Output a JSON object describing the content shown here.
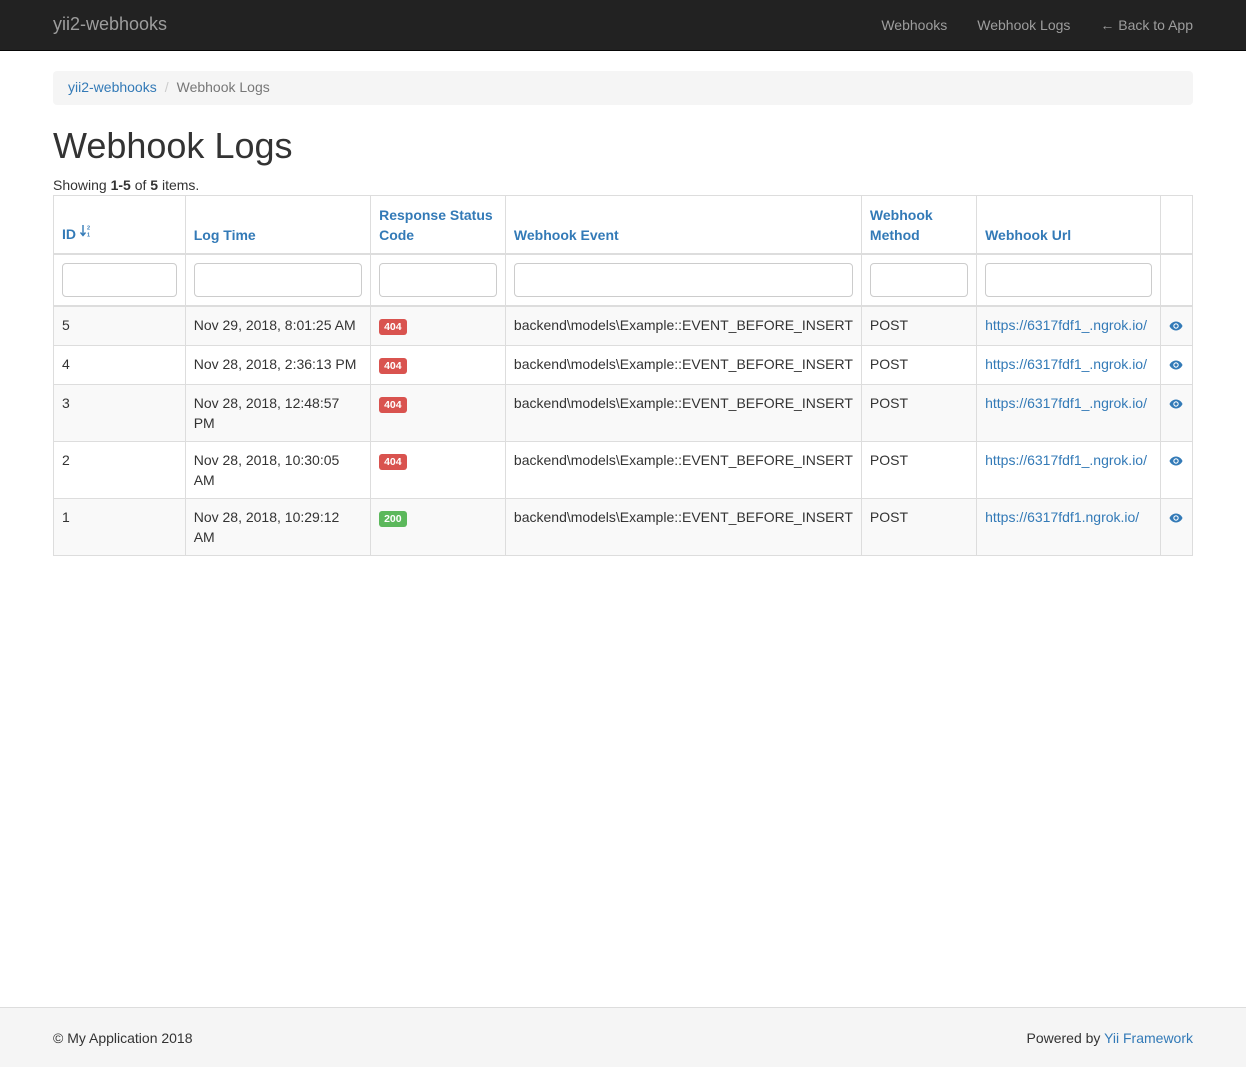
{
  "navbar": {
    "brand": "yii2-webhooks",
    "links": [
      "Webhooks",
      "Webhook Logs",
      "← Back to App"
    ]
  },
  "breadcrumb": {
    "home": "yii2-webhooks",
    "separator": "/",
    "current": "Webhook Logs"
  },
  "page_title": "Webhook Logs",
  "summary": {
    "prefix": "Showing ",
    "range": "1-5",
    "of": " of ",
    "total": "5",
    "suffix": " items."
  },
  "table": {
    "columns": [
      "ID",
      "Log Time",
      "Response Status Code",
      "Webhook Event",
      "Webhook Method",
      "Webhook Url"
    ],
    "rows": [
      {
        "id": "5",
        "time": "Nov 29, 2018, 8:01:25 AM",
        "status": "404",
        "event": "backend\\models\\Example::EVENT_BEFORE_INSERT",
        "method": "POST",
        "url": "https://6317fdf1_.ngrok.io/"
      },
      {
        "id": "4",
        "time": "Nov 28, 2018, 2:36:13 PM",
        "status": "404",
        "event": "backend\\models\\Example::EVENT_BEFORE_INSERT",
        "method": "POST",
        "url": "https://6317fdf1_.ngrok.io/"
      },
      {
        "id": "3",
        "time": "Nov 28, 2018, 12:48:57 PM",
        "status": "404",
        "event": "backend\\models\\Example::EVENT_BEFORE_INSERT",
        "method": "POST",
        "url": "https://6317fdf1_.ngrok.io/"
      },
      {
        "id": "2",
        "time": "Nov 28, 2018, 10:30:05 AM",
        "status": "404",
        "event": "backend\\models\\Example::EVENT_BEFORE_INSERT",
        "method": "POST",
        "url": "https://6317fdf1_.ngrok.io/"
      },
      {
        "id": "1",
        "time": "Nov 28, 2018, 10:29:12 AM",
        "status": "200",
        "event": "backend\\models\\Example::EVENT_BEFORE_INSERT",
        "method": "POST",
        "url": "https://6317fdf1.ngrok.io/"
      }
    ]
  },
  "icons": {
    "sort": "sort-numeric-asc-icon",
    "view": "eye-icon"
  },
  "colors": {
    "navbar": "#222222",
    "link": "#337ab7",
    "danger": "#d9534f",
    "success": "#5cb85c"
  },
  "footer": {
    "copyright": "© My Application 2018",
    "powered_prefix": "Powered by ",
    "powered_link": "Yii Framework"
  }
}
